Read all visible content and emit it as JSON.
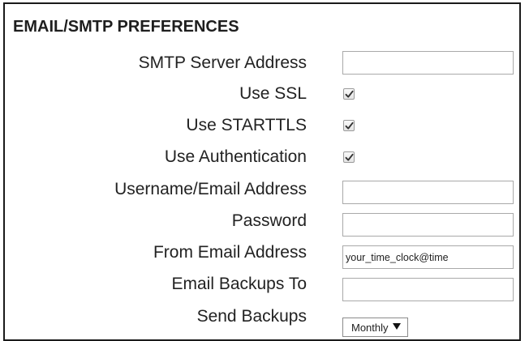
{
  "section": {
    "title": "EMAIL/SMTP PREFERENCES"
  },
  "fields": {
    "smtp_server": {
      "label": "SMTP Server Address",
      "value": ""
    },
    "use_ssl": {
      "label": "Use SSL",
      "checked": true
    },
    "use_starttls": {
      "label": "Use STARTTLS",
      "checked": true
    },
    "use_auth": {
      "label": "Use Authentication",
      "checked": true
    },
    "username": {
      "label": "Username/Email Address",
      "value": ""
    },
    "password": {
      "label": "Password",
      "value": ""
    },
    "from_email": {
      "label": "From Email Address",
      "value": "your_time_clock@time"
    },
    "backups_to": {
      "label": "Email Backups To",
      "value": ""
    },
    "send_backups": {
      "label": "Send Backups",
      "selected": "Monthly"
    }
  },
  "icons": {
    "checkmark": "checkmark-icon",
    "dropdown": "triangle-down-icon"
  }
}
